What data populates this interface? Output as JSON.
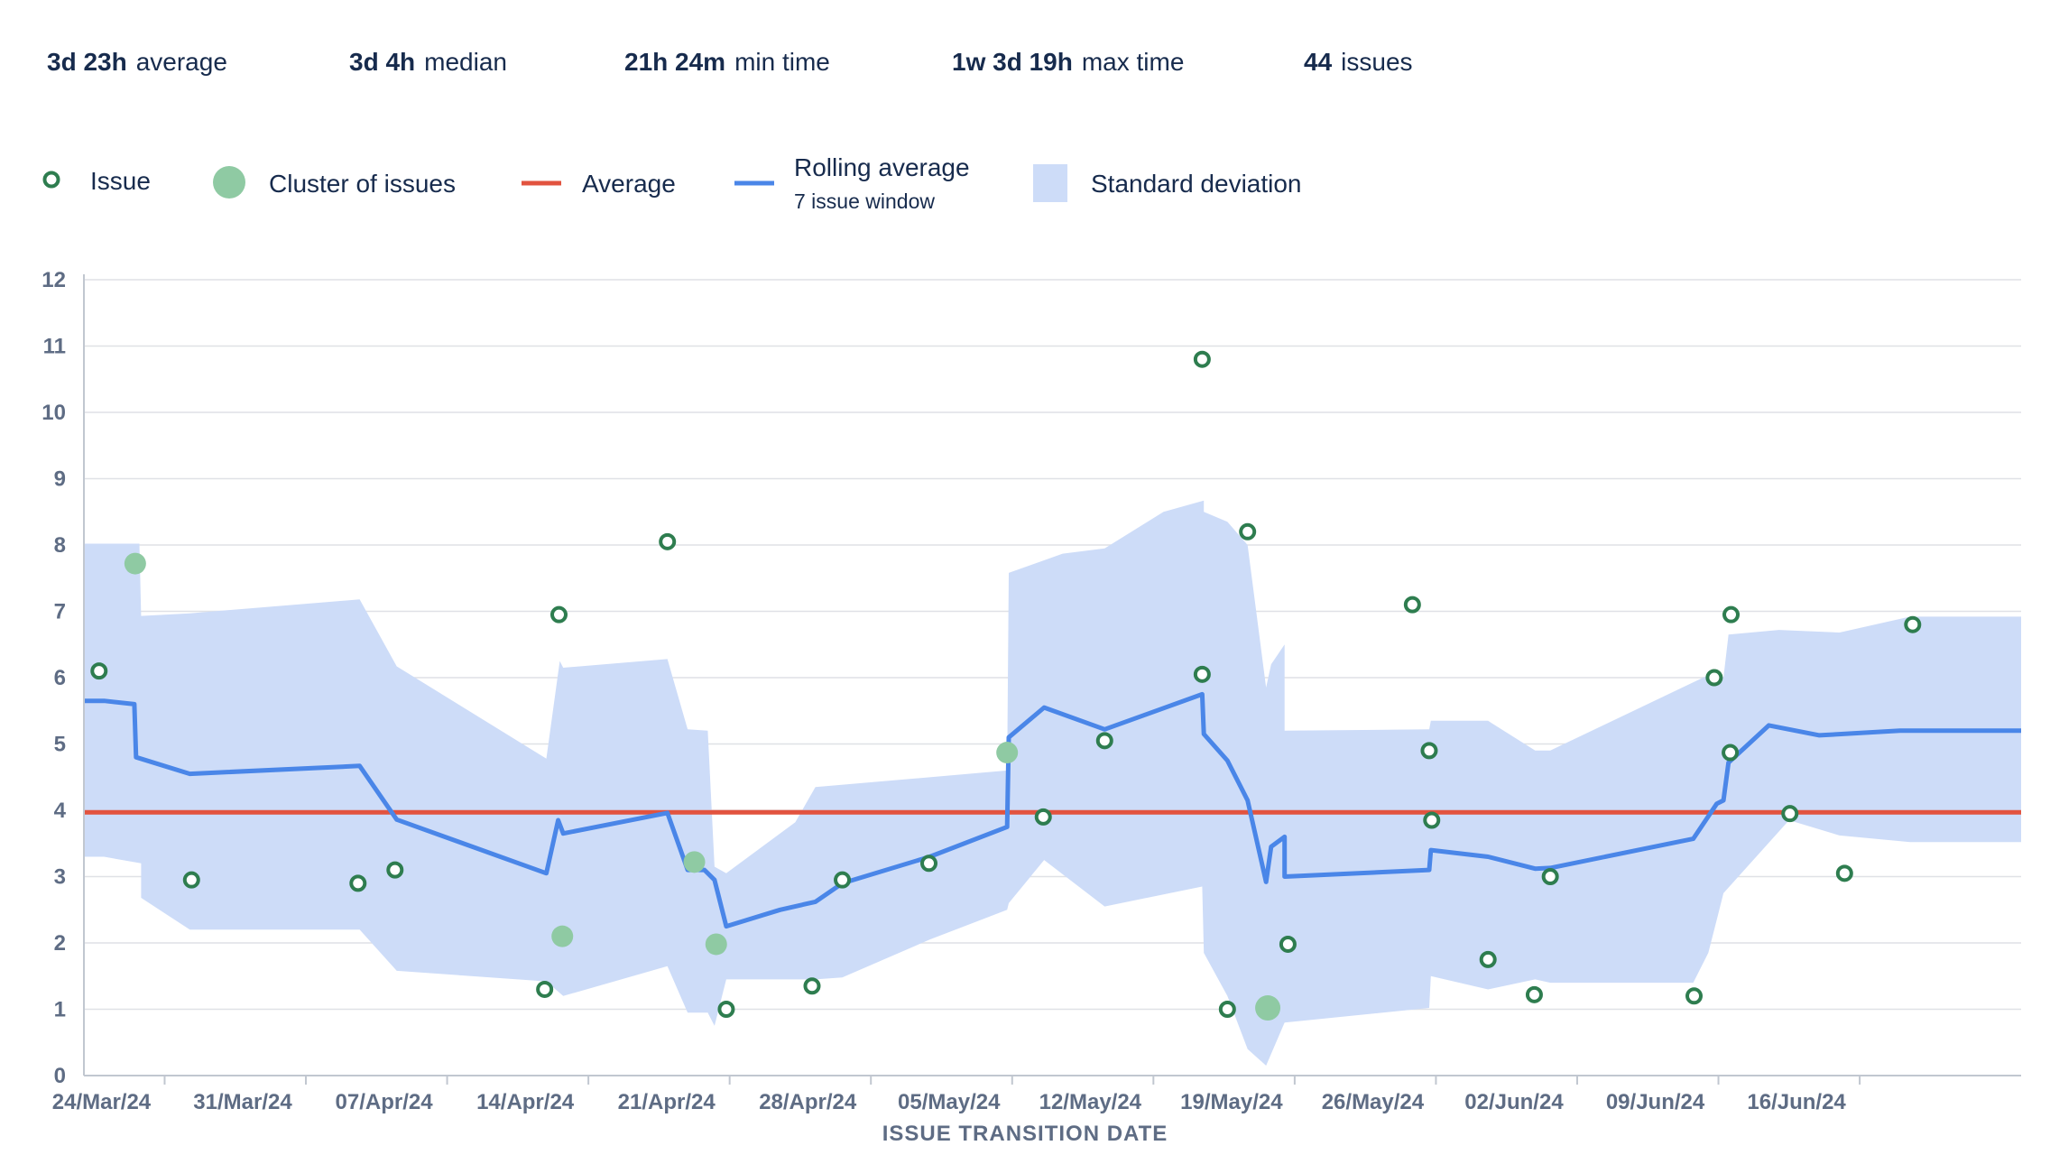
{
  "stats": [
    {
      "value": "3d 23h",
      "label": "average"
    },
    {
      "value": "3d 4h",
      "label": "median"
    },
    {
      "value": "21h 24m",
      "label": "min time"
    },
    {
      "value": "1w 3d 19h",
      "label": "max time"
    },
    {
      "value": "44",
      "label": "issues"
    }
  ],
  "legend": {
    "issue": "Issue",
    "cluster": "Cluster of issues",
    "average": "Average",
    "rolling": "Rolling average",
    "rolling_sub": "7 issue window",
    "stddev": "Standard deviation"
  },
  "colors": {
    "issue": "#2e7d4f",
    "cluster": "#8fcaa3",
    "average": "#e2533f",
    "rolling": "#4a86e8",
    "stddev": "#cddcf8",
    "grid": "#dfe1e6",
    "axis_text": "#5e6c84"
  },
  "chart_data": {
    "type": "scatter",
    "xlabel": "ISSUE TRANSITION DATE",
    "ylabel": "",
    "ylim": [
      0,
      12
    ],
    "yticks": [
      0,
      1,
      2,
      3,
      4,
      5,
      6,
      7,
      8,
      9,
      10,
      11,
      12
    ],
    "xlim": [
      "2024-03-20",
      "2024-06-24"
    ],
    "xticks": [
      {
        "date": "2024-03-24",
        "label": "24/Mar/24"
      },
      {
        "date": "2024-03-31",
        "label": "31/Mar/24"
      },
      {
        "date": "2024-04-07",
        "label": "07/Apr/24"
      },
      {
        "date": "2024-04-14",
        "label": "14/Apr/24"
      },
      {
        "date": "2024-04-21",
        "label": "21/Apr/24"
      },
      {
        "date": "2024-04-28",
        "label": "28/Apr/24"
      },
      {
        "date": "2024-05-05",
        "label": "05/May/24"
      },
      {
        "date": "2024-05-12",
        "label": "12/May/24"
      },
      {
        "date": "2024-05-19",
        "label": "19/May/24"
      },
      {
        "date": "2024-05-26",
        "label": "26/May/24"
      },
      {
        "date": "2024-06-02",
        "label": "02/Jun/24"
      },
      {
        "date": "2024-06-09",
        "label": "09/Jun/24"
      },
      {
        "date": "2024-06-16",
        "label": "16/Jun/24"
      }
    ],
    "average": 3.97,
    "issues": [
      {
        "x": "2024-03-20 18:00",
        "y": 6.1
      },
      {
        "x": "2024-03-25 08:00",
        "y": 2.95
      },
      {
        "x": "2024-04-02 14:00",
        "y": 2.9
      },
      {
        "x": "2024-04-04 10:00",
        "y": 3.1
      },
      {
        "x": "2024-04-11 20:00",
        "y": 1.3
      },
      {
        "x": "2024-04-12 13:00",
        "y": 6.95
      },
      {
        "x": "2024-04-17 22:00",
        "y": 8.05
      },
      {
        "x": "2024-04-20 20:00",
        "y": 1.0
      },
      {
        "x": "2024-04-25 02:00",
        "y": 1.35
      },
      {
        "x": "2024-04-26 14:00",
        "y": 2.95
      },
      {
        "x": "2024-04-30 21:00",
        "y": 3.2
      },
      {
        "x": "2024-05-06 13:00",
        "y": 3.9
      },
      {
        "x": "2024-05-09 14:00",
        "y": 5.05
      },
      {
        "x": "2024-05-14 10:00",
        "y": 10.8
      },
      {
        "x": "2024-05-14 10:00",
        "y": 6.05
      },
      {
        "x": "2024-05-15 16:00",
        "y": 1.0
      },
      {
        "x": "2024-05-16 16:00",
        "y": 8.2
      },
      {
        "x": "2024-05-18 16:00",
        "y": 1.98
      },
      {
        "x": "2024-05-24 20:00",
        "y": 7.1
      },
      {
        "x": "2024-05-25 16:00",
        "y": 4.9
      },
      {
        "x": "2024-05-25 19:00",
        "y": 3.85
      },
      {
        "x": "2024-05-28 14:00",
        "y": 1.75
      },
      {
        "x": "2024-05-30 21:00",
        "y": 1.22
      },
      {
        "x": "2024-05-31 16:00",
        "y": 3.0
      },
      {
        "x": "2024-06-07 19:00",
        "y": 1.2
      },
      {
        "x": "2024-06-08 19:00",
        "y": 6.0
      },
      {
        "x": "2024-06-09 14:00",
        "y": 4.87
      },
      {
        "x": "2024-06-09 15:00",
        "y": 6.95
      },
      {
        "x": "2024-06-12 13:00",
        "y": 3.95
      },
      {
        "x": "2024-06-15 06:00",
        "y": 3.05
      },
      {
        "x": "2024-06-18 15:00",
        "y": 6.8
      }
    ],
    "clusters": [
      {
        "x": "2024-03-22 13:00",
        "y": 7.72
      },
      {
        "x": "2024-04-12 17:00",
        "y": 2.1
      },
      {
        "x": "2024-04-19 06:00",
        "y": 3.22
      },
      {
        "x": "2024-04-20 08:00",
        "y": 1.98
      },
      {
        "x": "2024-05-04 18:00",
        "y": 4.87
      },
      {
        "x": "2024-05-17 16:00",
        "y": 1.02
      }
    ],
    "rolling_average": [
      [
        "2024-03-20 00:00",
        5.65
      ],
      [
        "2024-03-21 00:00",
        5.65
      ],
      [
        "2024-03-22 12:00",
        5.6
      ],
      [
        "2024-03-22 14:00",
        4.8
      ],
      [
        "2024-03-25 06:00",
        4.55
      ],
      [
        "2024-04-02 16:00",
        4.67
      ],
      [
        "2024-04-04 12:00",
        3.86
      ],
      [
        "2024-04-11 22:00",
        3.05
      ],
      [
        "2024-04-12 12:00",
        3.85
      ],
      [
        "2024-04-12 18:00",
        3.65
      ],
      [
        "2024-04-17 22:00",
        3.96
      ],
      [
        "2024-04-18 22:00",
        3.1
      ],
      [
        "2024-04-19 18:00",
        3.1
      ],
      [
        "2024-04-20 06:00",
        2.95
      ],
      [
        "2024-04-20 20:00",
        2.25
      ],
      [
        "2024-04-23 12:00",
        2.5
      ],
      [
        "2024-04-25 06:00",
        2.62
      ],
      [
        "2024-04-26 14:00",
        2.9
      ],
      [
        "2024-04-30 22:00",
        3.3
      ],
      [
        "2024-05-04 18:00",
        3.75
      ],
      [
        "2024-05-04 20:00",
        5.1
      ],
      [
        "2024-05-06 14:00",
        5.55
      ],
      [
        "2024-05-09 14:00",
        5.22
      ],
      [
        "2024-05-14 10:00",
        5.75
      ],
      [
        "2024-05-14 12:00",
        5.15
      ],
      [
        "2024-05-15 16:00",
        4.75
      ],
      [
        "2024-05-16 16:00",
        4.15
      ],
      [
        "2024-05-17 14:00",
        2.92
      ],
      [
        "2024-05-17 20:00",
        3.45
      ],
      [
        "2024-05-18 12:00",
        3.6
      ],
      [
        "2024-05-18 12:00",
        3.0
      ],
      [
        "2024-05-25 16:00",
        3.1
      ],
      [
        "2024-05-25 18:00",
        3.4
      ],
      [
        "2024-05-28 14:00",
        3.3
      ],
      [
        "2024-05-30 22:00",
        3.12
      ],
      [
        "2024-05-31 16:00",
        3.13
      ],
      [
        "2024-06-07 18:00",
        3.57
      ],
      [
        "2024-06-08 22:00",
        4.1
      ],
      [
        "2024-06-09 06:00",
        4.15
      ],
      [
        "2024-06-09 12:00",
        4.72
      ],
      [
        "2024-06-11 12:00",
        5.28
      ],
      [
        "2024-06-14 00:00",
        5.13
      ],
      [
        "2024-06-18 00:00",
        5.2
      ],
      [
        "2024-06-24 00:00",
        5.2
      ]
    ],
    "stddev_upper": [
      [
        "2024-03-20 00:00",
        8.02
      ],
      [
        "2024-03-22 18:00",
        8.02
      ],
      [
        "2024-03-22 20:00",
        6.93
      ],
      [
        "2024-03-25 06:00",
        6.97
      ],
      [
        "2024-04-02 16:00",
        7.18
      ],
      [
        "2024-04-04 12:00",
        6.17
      ],
      [
        "2024-04-11 22:00",
        4.78
      ],
      [
        "2024-04-12 14:00",
        6.25
      ],
      [
        "2024-04-12 18:00",
        6.15
      ],
      [
        "2024-04-17 22:00",
        6.28
      ],
      [
        "2024-04-18 22:00",
        5.22
      ],
      [
        "2024-04-19 22:00",
        5.2
      ],
      [
        "2024-04-20 06:00",
        3.15
      ],
      [
        "2024-04-20 20:00",
        3.05
      ],
      [
        "2024-04-24 06:00",
        3.82
      ],
      [
        "2024-04-25 06:00",
        4.35
      ],
      [
        "2024-05-04 18:00",
        4.6
      ],
      [
        "2024-05-04 20:00",
        7.58
      ],
      [
        "2024-05-07 12:00",
        7.87
      ],
      [
        "2024-05-09 14:00",
        7.95
      ],
      [
        "2024-05-12 12:00",
        8.5
      ],
      [
        "2024-05-14 12:00",
        8.67
      ],
      [
        "2024-05-14 12:00",
        8.5
      ],
      [
        "2024-05-15 16:00",
        8.35
      ],
      [
        "2024-05-16 16:00",
        8.0
      ],
      [
        "2024-05-17 14:00",
        5.85
      ],
      [
        "2024-05-17 20:00",
        6.2
      ],
      [
        "2024-05-18 12:00",
        6.5
      ],
      [
        "2024-05-18 12:00",
        5.2
      ],
      [
        "2024-05-25 16:00",
        5.22
      ],
      [
        "2024-05-25 18:00",
        5.35
      ],
      [
        "2024-05-28 14:00",
        5.35
      ],
      [
        "2024-05-30 22:00",
        4.9
      ],
      [
        "2024-05-31 16:00",
        4.9
      ],
      [
        "2024-06-08 22:00",
        6.1
      ],
      [
        "2024-06-09 06:00",
        6.0
      ],
      [
        "2024-06-09 12:00",
        6.65
      ],
      [
        "2024-06-12 00:00",
        6.72
      ],
      [
        "2024-06-15 00:00",
        6.68
      ],
      [
        "2024-06-18 12:00",
        6.92
      ],
      [
        "2024-06-24 00:00",
        6.92
      ]
    ],
    "stddev_lower": [
      [
        "2024-03-20 00:00",
        3.3
      ],
      [
        "2024-03-21 00:00",
        3.3
      ],
      [
        "2024-03-22 20:00",
        3.2
      ],
      [
        "2024-03-22 20:00",
        2.68
      ],
      [
        "2024-03-25 06:00",
        2.2
      ],
      [
        "2024-04-02 16:00",
        2.2
      ],
      [
        "2024-04-04 12:00",
        1.58
      ],
      [
        "2024-04-11 22:00",
        1.42
      ],
      [
        "2024-04-12 18:00",
        1.2
      ],
      [
        "2024-04-17 22:00",
        1.65
      ],
      [
        "2024-04-18 22:00",
        0.95
      ],
      [
        "2024-04-19 22:00",
        0.95
      ],
      [
        "2024-04-20 06:00",
        0.75
      ],
      [
        "2024-04-20 20:00",
        1.45
      ],
      [
        "2024-04-25 06:00",
        1.45
      ],
      [
        "2024-04-26 14:00",
        1.48
      ],
      [
        "2024-04-30 22:00",
        2.05
      ],
      [
        "2024-05-04 18:00",
        2.5
      ],
      [
        "2024-05-04 20:00",
        2.6
      ],
      [
        "2024-05-06 14:00",
        3.25
      ],
      [
        "2024-05-09 14:00",
        2.55
      ],
      [
        "2024-05-14 10:00",
        2.85
      ],
      [
        "2024-05-14 12:00",
        1.85
      ],
      [
        "2024-05-15 16:00",
        1.2
      ],
      [
        "2024-05-16 16:00",
        0.4
      ],
      [
        "2024-05-17 14:00",
        0.15
      ],
      [
        "2024-05-18 12:00",
        0.8
      ],
      [
        "2024-05-25 16:00",
        1.02
      ],
      [
        "2024-05-25 18:00",
        1.5
      ],
      [
        "2024-05-28 14:00",
        1.3
      ],
      [
        "2024-05-30 22:00",
        1.45
      ],
      [
        "2024-05-31 16:00",
        1.4
      ],
      [
        "2024-06-07 18:00",
        1.4
      ],
      [
        "2024-06-08 12:00",
        1.85
      ],
      [
        "2024-06-08 22:00",
        2.35
      ],
      [
        "2024-06-09 06:00",
        2.75
      ],
      [
        "2024-06-12 12:00",
        3.85
      ],
      [
        "2024-06-15 00:00",
        3.62
      ],
      [
        "2024-06-18 12:00",
        3.52
      ],
      [
        "2024-06-24 00:00",
        3.52
      ]
    ]
  }
}
